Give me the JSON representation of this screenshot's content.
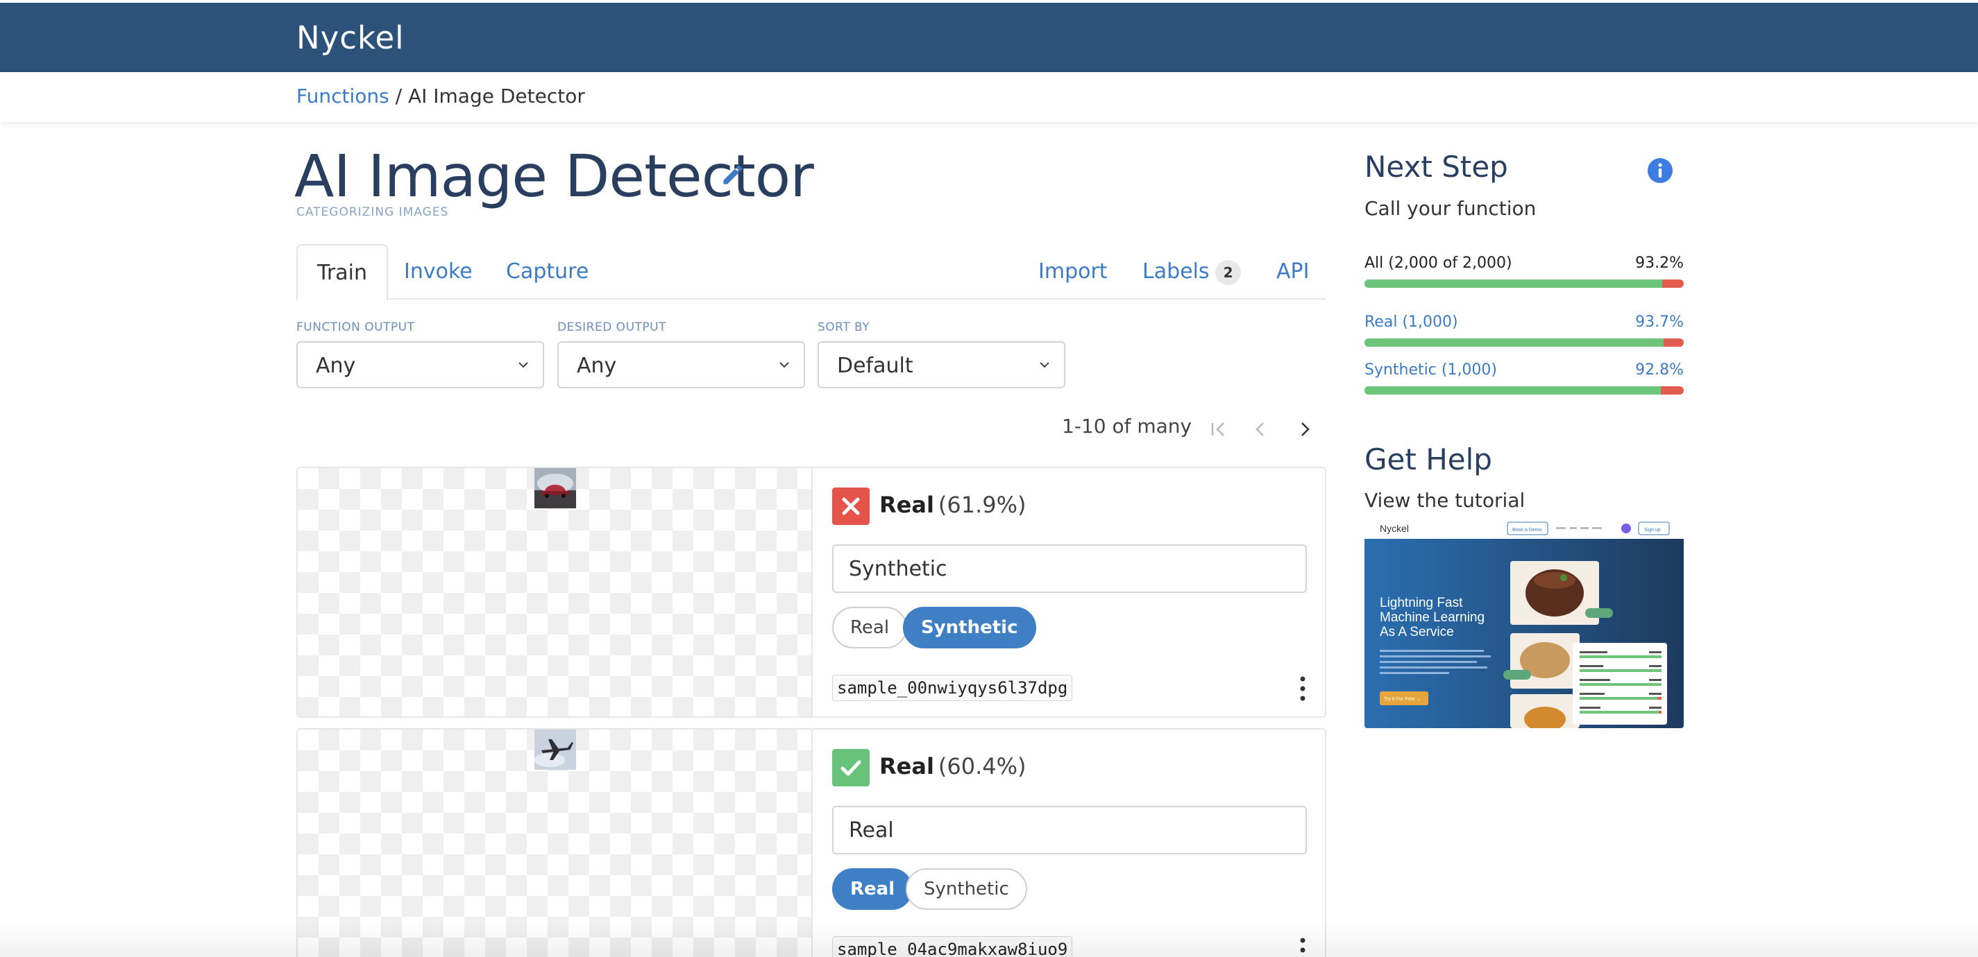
{
  "app": {
    "brand": "Nyckel"
  },
  "breadcrumb": {
    "root": "Functions",
    "separator": "/",
    "current": "AI Image Detector"
  },
  "function": {
    "title": "AI Image Detector",
    "subtitle": "CATEGORIZING IMAGES"
  },
  "tabs": {
    "left": [
      {
        "label": "Train",
        "active": true
      },
      {
        "label": "Invoke"
      },
      {
        "label": "Capture"
      }
    ],
    "right": [
      {
        "label": "Import"
      },
      {
        "label": "Labels",
        "badge": "2"
      },
      {
        "label": "API"
      }
    ]
  },
  "filters": [
    {
      "label": "FUNCTION OUTPUT",
      "value": "Any"
    },
    {
      "label": "DESIRED OUTPUT",
      "value": "Any"
    },
    {
      "label": "SORT BY",
      "value": "Default"
    }
  ],
  "pager": {
    "text": "1-10 of many"
  },
  "samples": [
    {
      "verdict": "wrong",
      "prediction": "Real",
      "confidence": "(61.9%)",
      "answer": "Synthetic",
      "options": [
        {
          "label": "Real",
          "selected": false
        },
        {
          "label": "Synthetic",
          "selected": true
        }
      ],
      "sample_id": "sample_00nwiyqys6l37dpg"
    },
    {
      "verdict": "correct",
      "prediction": "Real",
      "confidence": "(60.4%)",
      "answer": "Real",
      "options": [
        {
          "label": "Real",
          "selected": true
        },
        {
          "label": "Synthetic",
          "selected": false
        }
      ],
      "sample_id": "sample_04ac9makxaw8iuo9"
    }
  ],
  "sidebar": {
    "next_step": {
      "title": "Next Step",
      "subtitle": "Call your function"
    },
    "stats": [
      {
        "label": "All (2,000 of 2,000)",
        "pct": "93.2%",
        "value": 0.932,
        "link": false
      },
      {
        "label": "Real (1,000)",
        "pct": "93.7%",
        "value": 0.937,
        "link": true
      },
      {
        "label": "Synthetic (1,000)",
        "pct": "92.8%",
        "value": 0.928,
        "link": true
      }
    ],
    "help": {
      "title": "Get Help",
      "subtitle": "View the tutorial"
    },
    "tutorial": {
      "brand": "Nyckel",
      "headline_1": "Lightning Fast",
      "headline_2": "Machine Learning",
      "headline_3": "As A Service",
      "cta": "Try It For Free →",
      "nav_book": "Book a Demo",
      "nav_signup": "Sign up"
    }
  },
  "colors": {
    "header": "#2c5279",
    "link": "#3c7bc4",
    "accent": "#3f7fc3",
    "success": "#6cc57b",
    "error": "#e25c4f"
  }
}
